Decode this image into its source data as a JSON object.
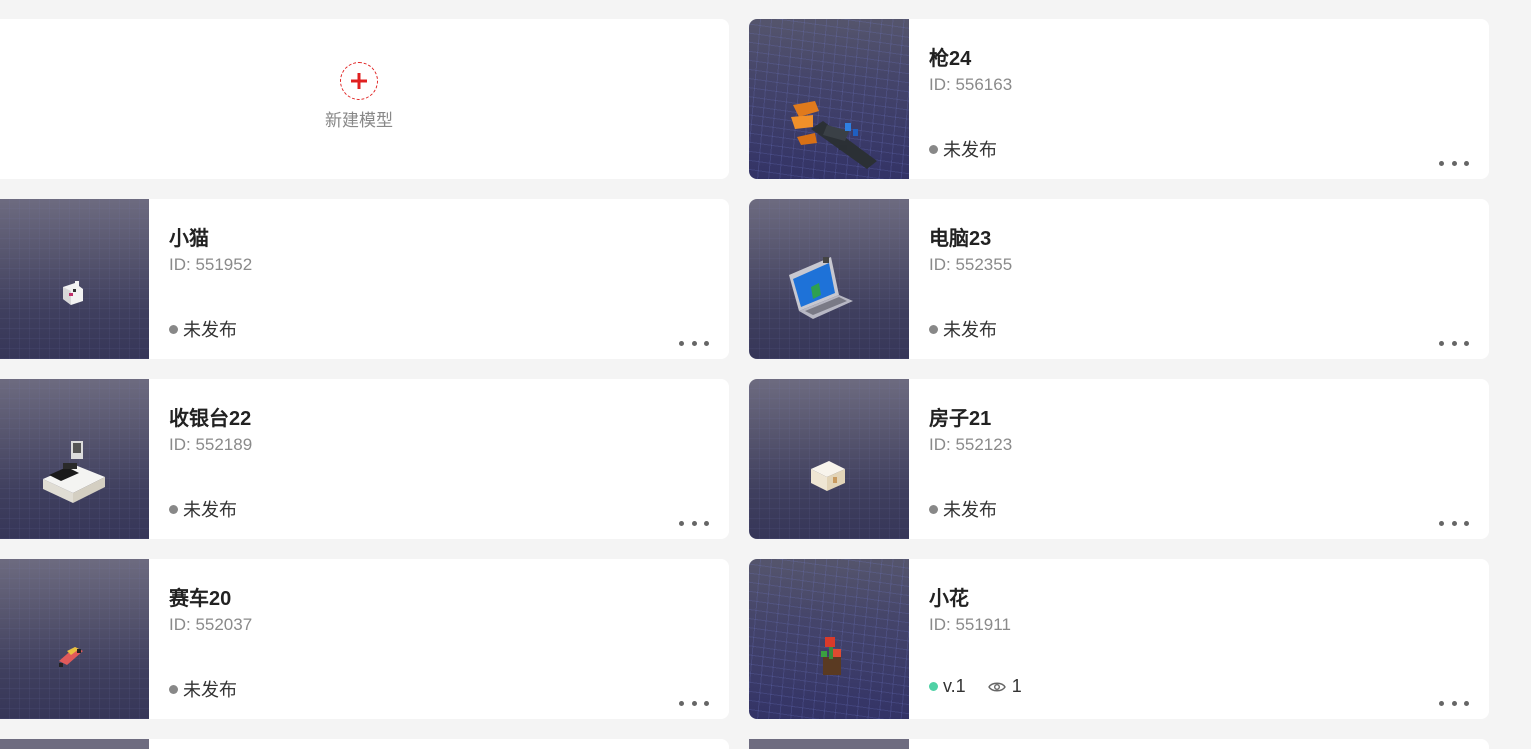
{
  "new_model": {
    "label": "新建模型"
  },
  "models": [
    {
      "title": "枪24",
      "id_text": "ID: 556163",
      "status": "未发布",
      "thumb_icon": "gun-model-icon"
    },
    {
      "title": "小猫",
      "id_text": "ID: 551952",
      "status": "未发布",
      "thumb_icon": "cat-model-icon"
    },
    {
      "title": "电脑23",
      "id_text": "ID: 552355",
      "status": "未发布",
      "thumb_icon": "laptop-model-icon"
    },
    {
      "title": "收银台22",
      "id_text": "ID: 552189",
      "status": "未发布",
      "thumb_icon": "cash-register-model-icon"
    },
    {
      "title": "房子21",
      "id_text": "ID: 552123",
      "status": "未发布",
      "thumb_icon": "house-model-icon"
    },
    {
      "title": "赛车20",
      "id_text": "ID: 552037",
      "status": "未发布",
      "thumb_icon": "race-car-model-icon"
    },
    {
      "title": "小花",
      "id_text": "ID: 551911",
      "status": "v.1",
      "views": "1",
      "thumb_icon": "flower-model-icon"
    }
  ],
  "colors": {
    "accent": "#e02020",
    "unpublished_dot": "#888888",
    "published_dot": "#4fd1a5",
    "background": "#f4f4f4"
  }
}
